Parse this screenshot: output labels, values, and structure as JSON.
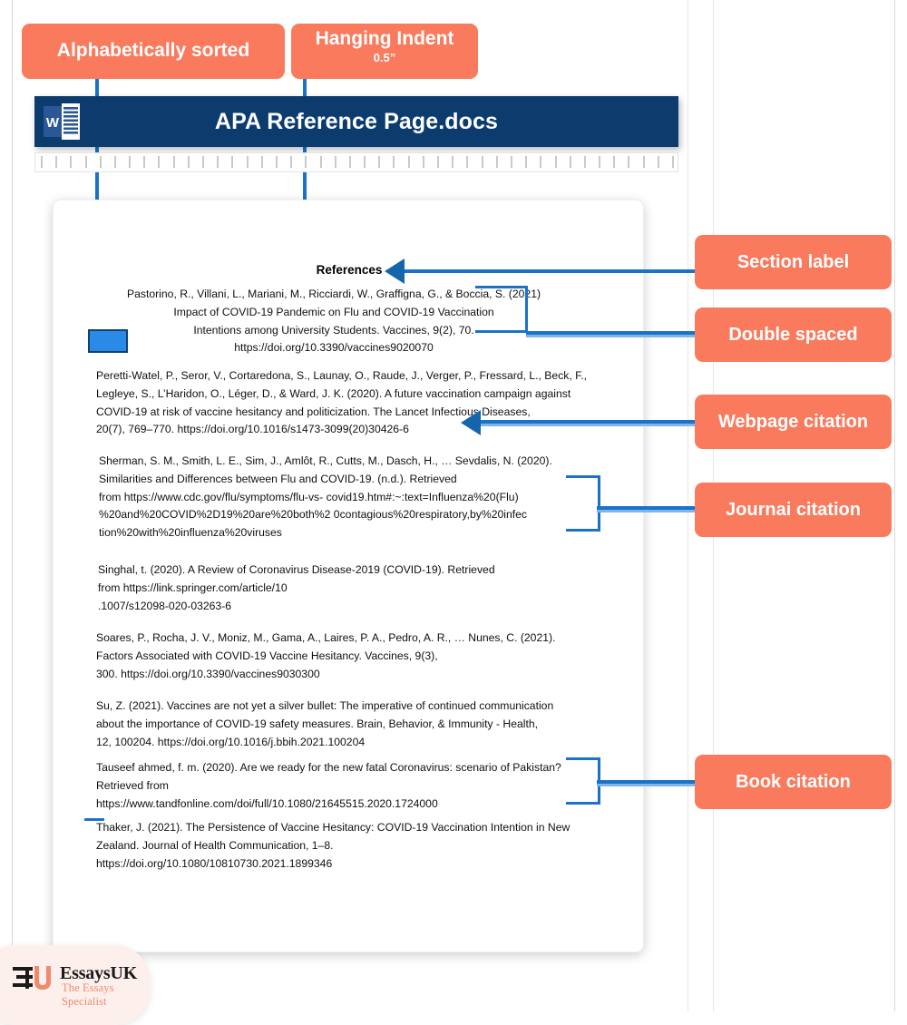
{
  "colors": {
    "callout_bg": "#fa7a5d",
    "connector_blue": "#1a73c8",
    "word_header_bg": "#0c3c6e",
    "indent_marker": "#2a8ae8"
  },
  "window": {
    "title": "APA Reference Page.docs",
    "app_icon": "word-icon"
  },
  "callouts": {
    "alphabetical": {
      "label": "Alphabetically sorted"
    },
    "hanging_indent": {
      "label": "Hanging Indent",
      "sub": "0.5”"
    },
    "section_label": {
      "label": "Section label"
    },
    "double_spaced": {
      "label": "Double spaced"
    },
    "webpage_citation": {
      "label": "Webpage citation"
    },
    "journal_citation": {
      "label": "Journai citation"
    },
    "book_citation": {
      "label": "Book citation"
    }
  },
  "document": {
    "heading": "References",
    "references": [
      {
        "id": "pastorino",
        "align": "centered",
        "lines": [
          "Pastorino, R., Villani, L., Mariani, M., Ricciardi, W., Graffigna, G., & Boccia, S. (2021)",
          "Impact of COVID-19 Pandemic on Flu and COVID-19 Vaccination",
          "Intentions among University Students. Vaccines, 9(2), 70.",
          "https://doi.org/10.3390/vaccines9020070"
        ]
      },
      {
        "id": "peretti-watel",
        "align": "left",
        "lines": [
          "Peretti-Watel, P., Seror, V., Cortaredona, S., Launay, O., Raude, J., Verger, P., Fressard, L., Beck, F.,",
          " Legleye, S., L’Haridon, O., Léger, D., & Ward, J. K. (2020). A future vaccination campaign against",
          "COVID-19 at risk of vaccine hesitancy and politicization. The Lancet Infectious Diseases,",
          "20(7), 769–770. https://doi.org/10.1016/s1473-3099(20)30426-6"
        ]
      },
      {
        "id": "sherman",
        "align": "left",
        "lines": [
          "Sherman, S. M., Smith, L. E., Sim, J., Amlôt, R., Cutts, M., Dasch, H., … Sevdalis, N. (2020).",
          "Similarities and Differences between Flu and COVID-19. (n.d.). Retrieved",
          "from https://www.cdc.gov/flu/symptoms/flu-vs- covid19.htm#:~:text=Influenza%20(Flu)",
          "%20and%20COVID%2D19%20are%20both%2 0contagious%20respiratory,by%20infec",
          "tion%20with%20influenza%20viruses"
        ]
      },
      {
        "id": "singhal",
        "align": "left",
        "lines": [
          "Singhal, t. (2020). A Review of Coronavirus Disease-2019 (COVID-19). Retrieved",
          "from https://link.springer.com/article/10",
          ".1007/s12098-020-03263-6"
        ]
      },
      {
        "id": "soares",
        "align": "left",
        "lines": [
          "Soares, P., Rocha, J. V., Moniz, M., Gama, A., Laires, P. A., Pedro, A. R., … Nunes, C. (2021).",
          "Factors Associated with COVID-19 Vaccine Hesitancy. Vaccines, 9(3),",
          "300. https://doi.org/10.3390/vaccines9030300"
        ]
      },
      {
        "id": "su",
        "align": "left",
        "lines": [
          "Su, Z. (2021). Vaccines are not yet a silver bullet: The imperative of continued communication",
          "about the importance of COVID-19 safety measures. Brain, Behavior, & Immunity - Health,",
          " 12, 100204. https://doi.org/10.1016/j.bbih.2021.100204"
        ]
      },
      {
        "id": "tauseef",
        "align": "left",
        "lines": [
          "Tauseef ahmed, f. m. (2020). Are we ready for the new fatal Coronavirus: scenario of Pakistan?",
          "Retrieved from",
          " https://www.tandfonline.com/doi/full/10.1080/21645515.2020.1724000"
        ]
      },
      {
        "id": "thaker",
        "align": "left",
        "lines": [
          "Thaker, J. (2021). The Persistence of Vaccine Hesitancy: COVID-19 Vaccination Intention in New",
          "Zealand. Journal of Health Communication, 1–8.",
          "https://doi.org/10.1080/10810730.2021.1899346"
        ]
      }
    ]
  },
  "branding": {
    "logo_name": "EssaysUK",
    "logo_tagline": "The Essays Specialist"
  }
}
